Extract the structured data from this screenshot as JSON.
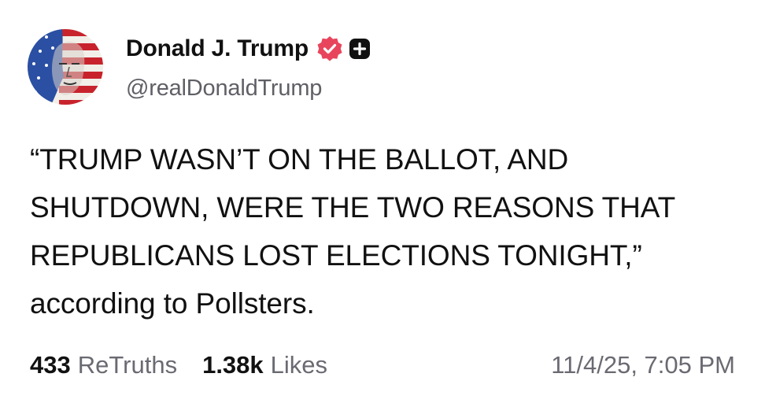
{
  "author": {
    "display_name": "Donald J. Trump",
    "handle": "@realDonaldTrump",
    "avatar_icon": "flag-portrait-avatar",
    "verified_icon": "verified-badge-icon",
    "plus_icon": "plus-badge-icon"
  },
  "post": {
    "lines": [
      "“TRUMP WASN’T ON THE BALLOT, AND",
      "SHUTDOWN, WERE THE TWO REASONS THAT",
      "REPUBLICANS LOST ELECTIONS TONIGHT,”",
      "according to Pollsters."
    ]
  },
  "stats": {
    "retruths_count": "433",
    "retruths_label": "ReTruths",
    "likes_count": "1.38k",
    "likes_label": "Likes",
    "timestamp": "11/4/25, 7:05 PM"
  },
  "colors": {
    "text": "#111111",
    "muted": "#6a6a72",
    "verified": "#e8455c"
  }
}
